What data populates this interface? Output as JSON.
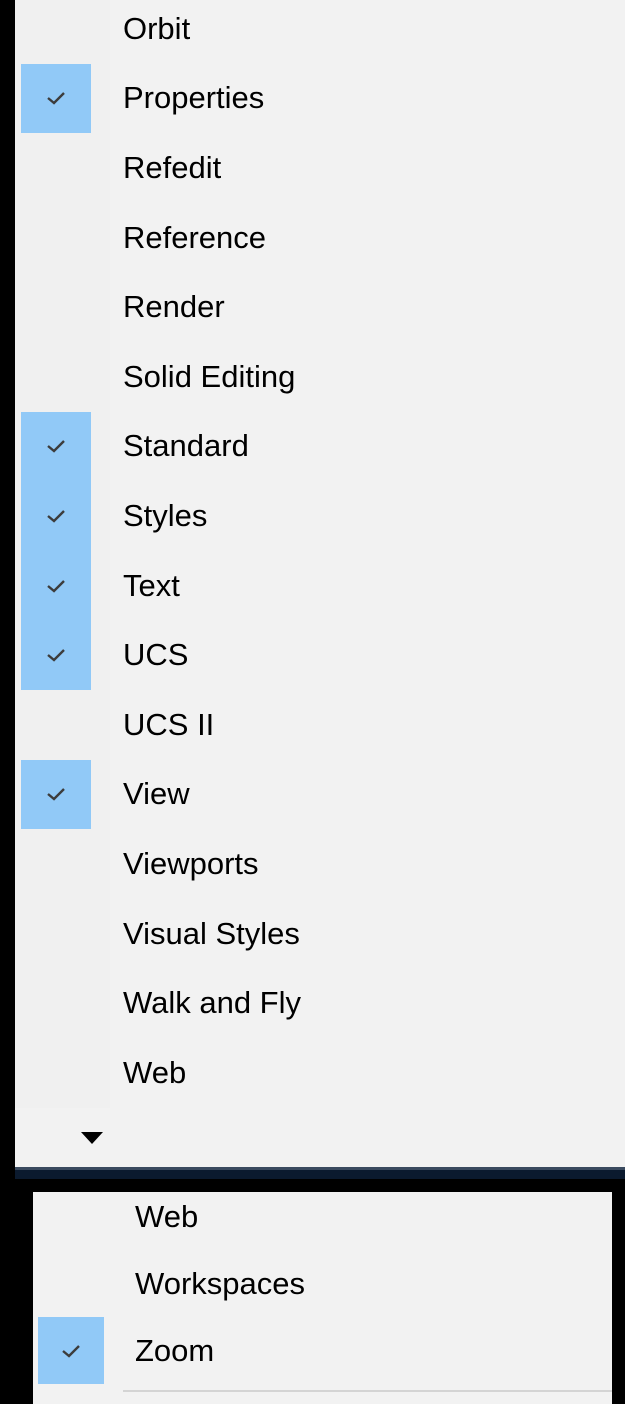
{
  "menu_main": {
    "items": [
      {
        "label": "Orbit",
        "checked": false
      },
      {
        "label": "Properties",
        "checked": true
      },
      {
        "label": "Refedit",
        "checked": false
      },
      {
        "label": "Reference",
        "checked": false
      },
      {
        "label": "Render",
        "checked": false
      },
      {
        "label": "Solid Editing",
        "checked": false
      },
      {
        "label": "Standard",
        "checked": true
      },
      {
        "label": "Styles",
        "checked": true
      },
      {
        "label": "Text",
        "checked": true
      },
      {
        "label": "UCS",
        "checked": true
      },
      {
        "label": "UCS II",
        "checked": false
      },
      {
        "label": "View",
        "checked": true
      },
      {
        "label": "Viewports",
        "checked": false
      },
      {
        "label": "Visual Styles",
        "checked": false
      },
      {
        "label": "Walk and Fly",
        "checked": false
      },
      {
        "label": "Web",
        "checked": false
      }
    ],
    "scroll_icon": "triangle-down-icon"
  },
  "menu_continued": {
    "items": [
      {
        "label": "Web",
        "checked": false
      },
      {
        "label": "Workspaces",
        "checked": false
      },
      {
        "label": "Zoom",
        "checked": true
      }
    ]
  },
  "colors": {
    "check_highlight": "#91c9f7",
    "menu_bg": "#f2f2f2"
  }
}
